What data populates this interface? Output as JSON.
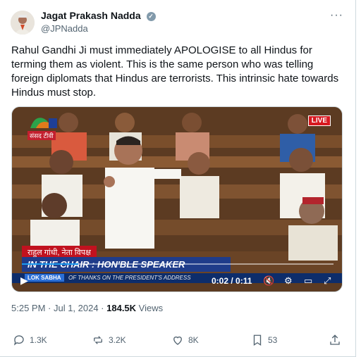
{
  "author": {
    "name": "Jagat Prakash Nadda",
    "handle": "@JPNadda",
    "verified_icon": "verified-badge-icon"
  },
  "tweet": {
    "text": "Rahul Gandhi Ji must immediately APOLOGISE to all Hindus for terming them as violent. This is the same person who was telling foreign diplomats that Hindus are terrorists. This intrinsic hate towards Hindus must stop."
  },
  "video": {
    "channel": "संसद टीवी",
    "live": "LIVE",
    "caption_name": "राहुल गांधी, नेता विपक्ष",
    "caption_chair": "IN THE CHAIR : HON'BLE SPEAKER",
    "ticker_tag": "LOK SABHA",
    "ticker_text": "OF THANKS ON THE PRESIDENT'S ADDRESS",
    "time": "0:02 / 0:11",
    "played_fraction": 0.18
  },
  "meta": {
    "time": "5:25 PM · Jul 1, 2024 · ",
    "views_count": "184.5K",
    "views_label": " Views"
  },
  "actions": {
    "replies": "1.3K",
    "reposts": "3.2K",
    "likes": "8K",
    "bookmarks": "53"
  }
}
